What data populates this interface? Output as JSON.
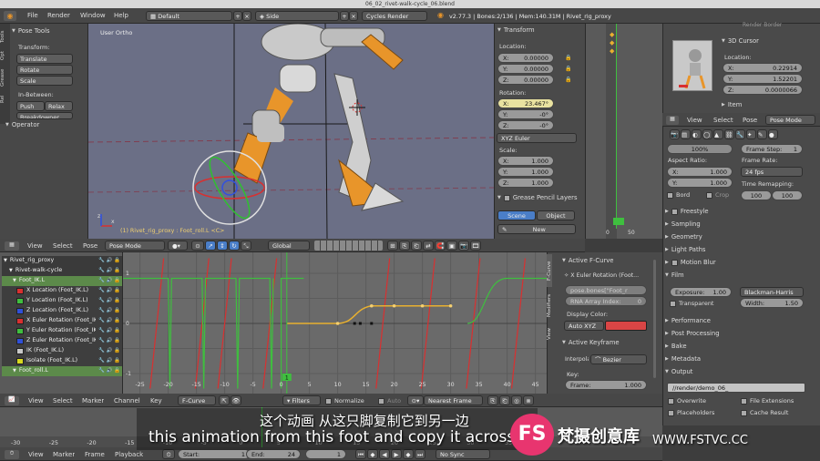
{
  "window_title": "06_02_rivet-walk-cycle_06.blend",
  "top_menu": {
    "file": "File",
    "render": "Render",
    "window": "Window",
    "help": "Help",
    "layout": "Default",
    "scene": "Side",
    "engine": "Cycles Render",
    "stats": "v2.77.3 | Bones:2/136 | Mem:140.31M | Rivet_rig_proxy"
  },
  "left_toolbar": {
    "title": "Pose Tools",
    "transform_label": "Transform:",
    "translate": "Translate",
    "rotate": "Rotate",
    "scale": "Scale",
    "inbetween_label": "In-Between:",
    "push": "Push",
    "relax": "Relax",
    "breakdowner": "Breakdowner",
    "operator": "Operator",
    "side_tabs": [
      "Tools",
      "Opt",
      "Grease",
      "Rel"
    ]
  },
  "viewport": {
    "label": "User Ortho",
    "status": "(1) Rivet_rig_proxy : Foot_roll.L <C>"
  },
  "transform_panel": {
    "title": "Transform",
    "location_label": "Location:",
    "loc": [
      {
        "a": "X:",
        "v": "0.00000"
      },
      {
        "a": "Y:",
        "v": "0.00000"
      },
      {
        "a": "Z:",
        "v": "0.00000"
      }
    ],
    "rotation_label": "Rotation:",
    "rot": [
      {
        "a": "X:",
        "v": "23.467°"
      },
      {
        "a": "Y:",
        "v": "-0°"
      },
      {
        "a": "Z:",
        "v": "-0°"
      }
    ],
    "rotmode": "XYZ Euler",
    "scale_label": "Scale:",
    "scl": [
      {
        "a": "X:",
        "v": "1.000"
      },
      {
        "a": "Y:",
        "v": "1.000"
      },
      {
        "a": "Z:",
        "v": "1.000"
      }
    ],
    "grease": "Grease Pencil Layers",
    "scene_tab": "Scene",
    "object_tab": "Object",
    "new_btn": "New"
  },
  "mini_timeline": {
    "ticks": [
      "0",
      "50"
    ]
  },
  "properties_top": {
    "render_border": "Render Border",
    "cursor_title": "3D Cursor",
    "location_label": "Location:",
    "cursor": [
      {
        "a": "X:",
        "v": "0.22914"
      },
      {
        "a": "Y:",
        "v": "1.52201"
      },
      {
        "a": "Z:",
        "v": "0.0000066"
      }
    ],
    "item": "Item",
    "menu": [
      "View",
      "Select",
      "Pose"
    ],
    "mode": "Pose Mode"
  },
  "properties": {
    "resolution": "100%",
    "frame_step_label": "Frame Step:",
    "frame_step": "1",
    "aspect_label": "Aspect Ratio:",
    "aspect_x": "1.000",
    "aspect_y": "1.000",
    "frame_rate_label": "Frame Rate:",
    "fps": "24 fps",
    "time_remap": "Time Remapping:",
    "remap_a": "100",
    "remap_b": "100",
    "bord": "Bord",
    "crop": "Crop",
    "sections": [
      "Freestyle",
      "Sampling",
      "Geometry",
      "Light Paths",
      "Motion Blur",
      "Film"
    ],
    "exposure_label": "Exposure:",
    "exposure": "1.00",
    "filter": "Blackman-Harris",
    "transparent": "Transparent",
    "width_label": "Width:",
    "width": "1.50",
    "sections2": [
      "Performance",
      "Post Processing",
      "Bake",
      "Metadata",
      "Output"
    ],
    "output_path": "//render/demo_06_",
    "overwrite": "Overwrite",
    "file_ext": "File Extensions",
    "placeholders": "Placeholders",
    "cache_result": "Cache Result"
  },
  "view3d_header": {
    "view": "View",
    "select": "Select",
    "pose": "Pose",
    "mode": "Pose Mode",
    "orientation": "Global"
  },
  "channels": [
    {
      "name": "Rivet_rig_proxy",
      "color": "#3a3a3a",
      "indent": 0,
      "sw": null
    },
    {
      "name": "Rivet-walk-cycle",
      "color": "#3a3a3a",
      "indent": 6,
      "sw": null
    },
    {
      "name": "Foot_IK.L",
      "color": "#5c8a4a",
      "indent": 10,
      "sw": null
    },
    {
      "name": "X Location (Foot_IK.L)",
      "color": "#3e3e3e",
      "indent": 14,
      "sw": "#d93030"
    },
    {
      "name": "Y Location (Foot_IK.L)",
      "color": "#3e3e3e",
      "indent": 14,
      "sw": "#3fbf3f"
    },
    {
      "name": "Z Location (Foot_IK.L)",
      "color": "#3e3e3e",
      "indent": 14,
      "sw": "#3050d8"
    },
    {
      "name": "X Euler Rotation (Foot_IK.L)",
      "color": "#3e3e3e",
      "indent": 14,
      "sw": "#d93030"
    },
    {
      "name": "Y Euler Rotation (Foot_IK.L)",
      "color": "#3e3e3e",
      "indent": 14,
      "sw": "#3fbf3f"
    },
    {
      "name": "Z Euler Rotation (Foot_IK.L)",
      "color": "#3e3e3e",
      "indent": 14,
      "sw": "#3050d8"
    },
    {
      "name": "IK (Foot_IK.L)",
      "color": "#3e3e3e",
      "indent": 14,
      "sw": "#c8c8c8"
    },
    {
      "name": "Isolate (Foot_IK.L)",
      "color": "#3e3e3e",
      "indent": 14,
      "sw": "#d8d820"
    },
    {
      "name": "Foot_roll.L",
      "color": "#5c8a4a",
      "indent": 10,
      "sw": null
    }
  ],
  "graph": {
    "x_ticks": [
      "-25",
      "-20",
      "-15",
      "-10",
      "-5",
      "0",
      "5",
      "10",
      "15",
      "20",
      "25",
      "30",
      "35",
      "40",
      "45"
    ],
    "x_values": [
      -25,
      -20,
      -15,
      -10,
      -5,
      0,
      5,
      10,
      15,
      20,
      25,
      30,
      35,
      40,
      45
    ],
    "y_ticks": [
      "1",
      "0",
      "-1"
    ],
    "current_frame": "1"
  },
  "fcurve_panel": {
    "tabs": [
      "F-Curve",
      "Modifiers",
      "View"
    ],
    "active_fcurve": "Active F-Curve",
    "curve_name": "X Euler Rotation (Foot...",
    "path": "pose.bones[\"Foot_r",
    "array_index": "RNA Array Index:",
    "array_value": "0",
    "display_color": "Display Color:",
    "auto_xyz": "Auto XYZ",
    "active_keyframe": "Active Keyframe",
    "interp_label": "Interpolation:",
    "interp": "Bezier",
    "key_label": "Key:",
    "frame_label": "Frame:",
    "frame_value": "1.000"
  },
  "graph_header": {
    "view": "View",
    "select": "Select",
    "marker": "Marker",
    "channel": "Channel",
    "key": "Key",
    "mode": "F-Curve",
    "filters": "Filters",
    "normalize": "Normalize",
    "auto": "Auto",
    "pivot": "Nearest Frame"
  },
  "bottom_ruler": [
    "-30",
    "-25",
    "-20",
    "-15",
    "-10",
    "-5",
    "0",
    "5",
    "10",
    "15",
    "20",
    "25",
    "30",
    "35"
  ],
  "timeline_header": {
    "view": "View",
    "marker": "Marker",
    "frame": "Frame",
    "playback": "Playback",
    "start_label": "Start:",
    "start": "1",
    "end_label": "End:",
    "end": "24",
    "current": "1",
    "sync": "No Sync"
  },
  "subtitle": {
    "cn": "这个动画 从这只脚复制它到另一边",
    "en": "this animation from this foot and copy it across to"
  },
  "watermark": {
    "logo": "FS",
    "name": "梵摄创意库",
    "url": "WWW.FSTVC.CC"
  },
  "colors": {
    "viewport_bg": "#6b6f86",
    "graph_bg": "#6a6a6a",
    "accent_orange": "#e8952a",
    "highlight_yellow": "#e9e2a0",
    "selected_blue": "#4a7ec8",
    "watermark_pink": "#e8356f"
  }
}
